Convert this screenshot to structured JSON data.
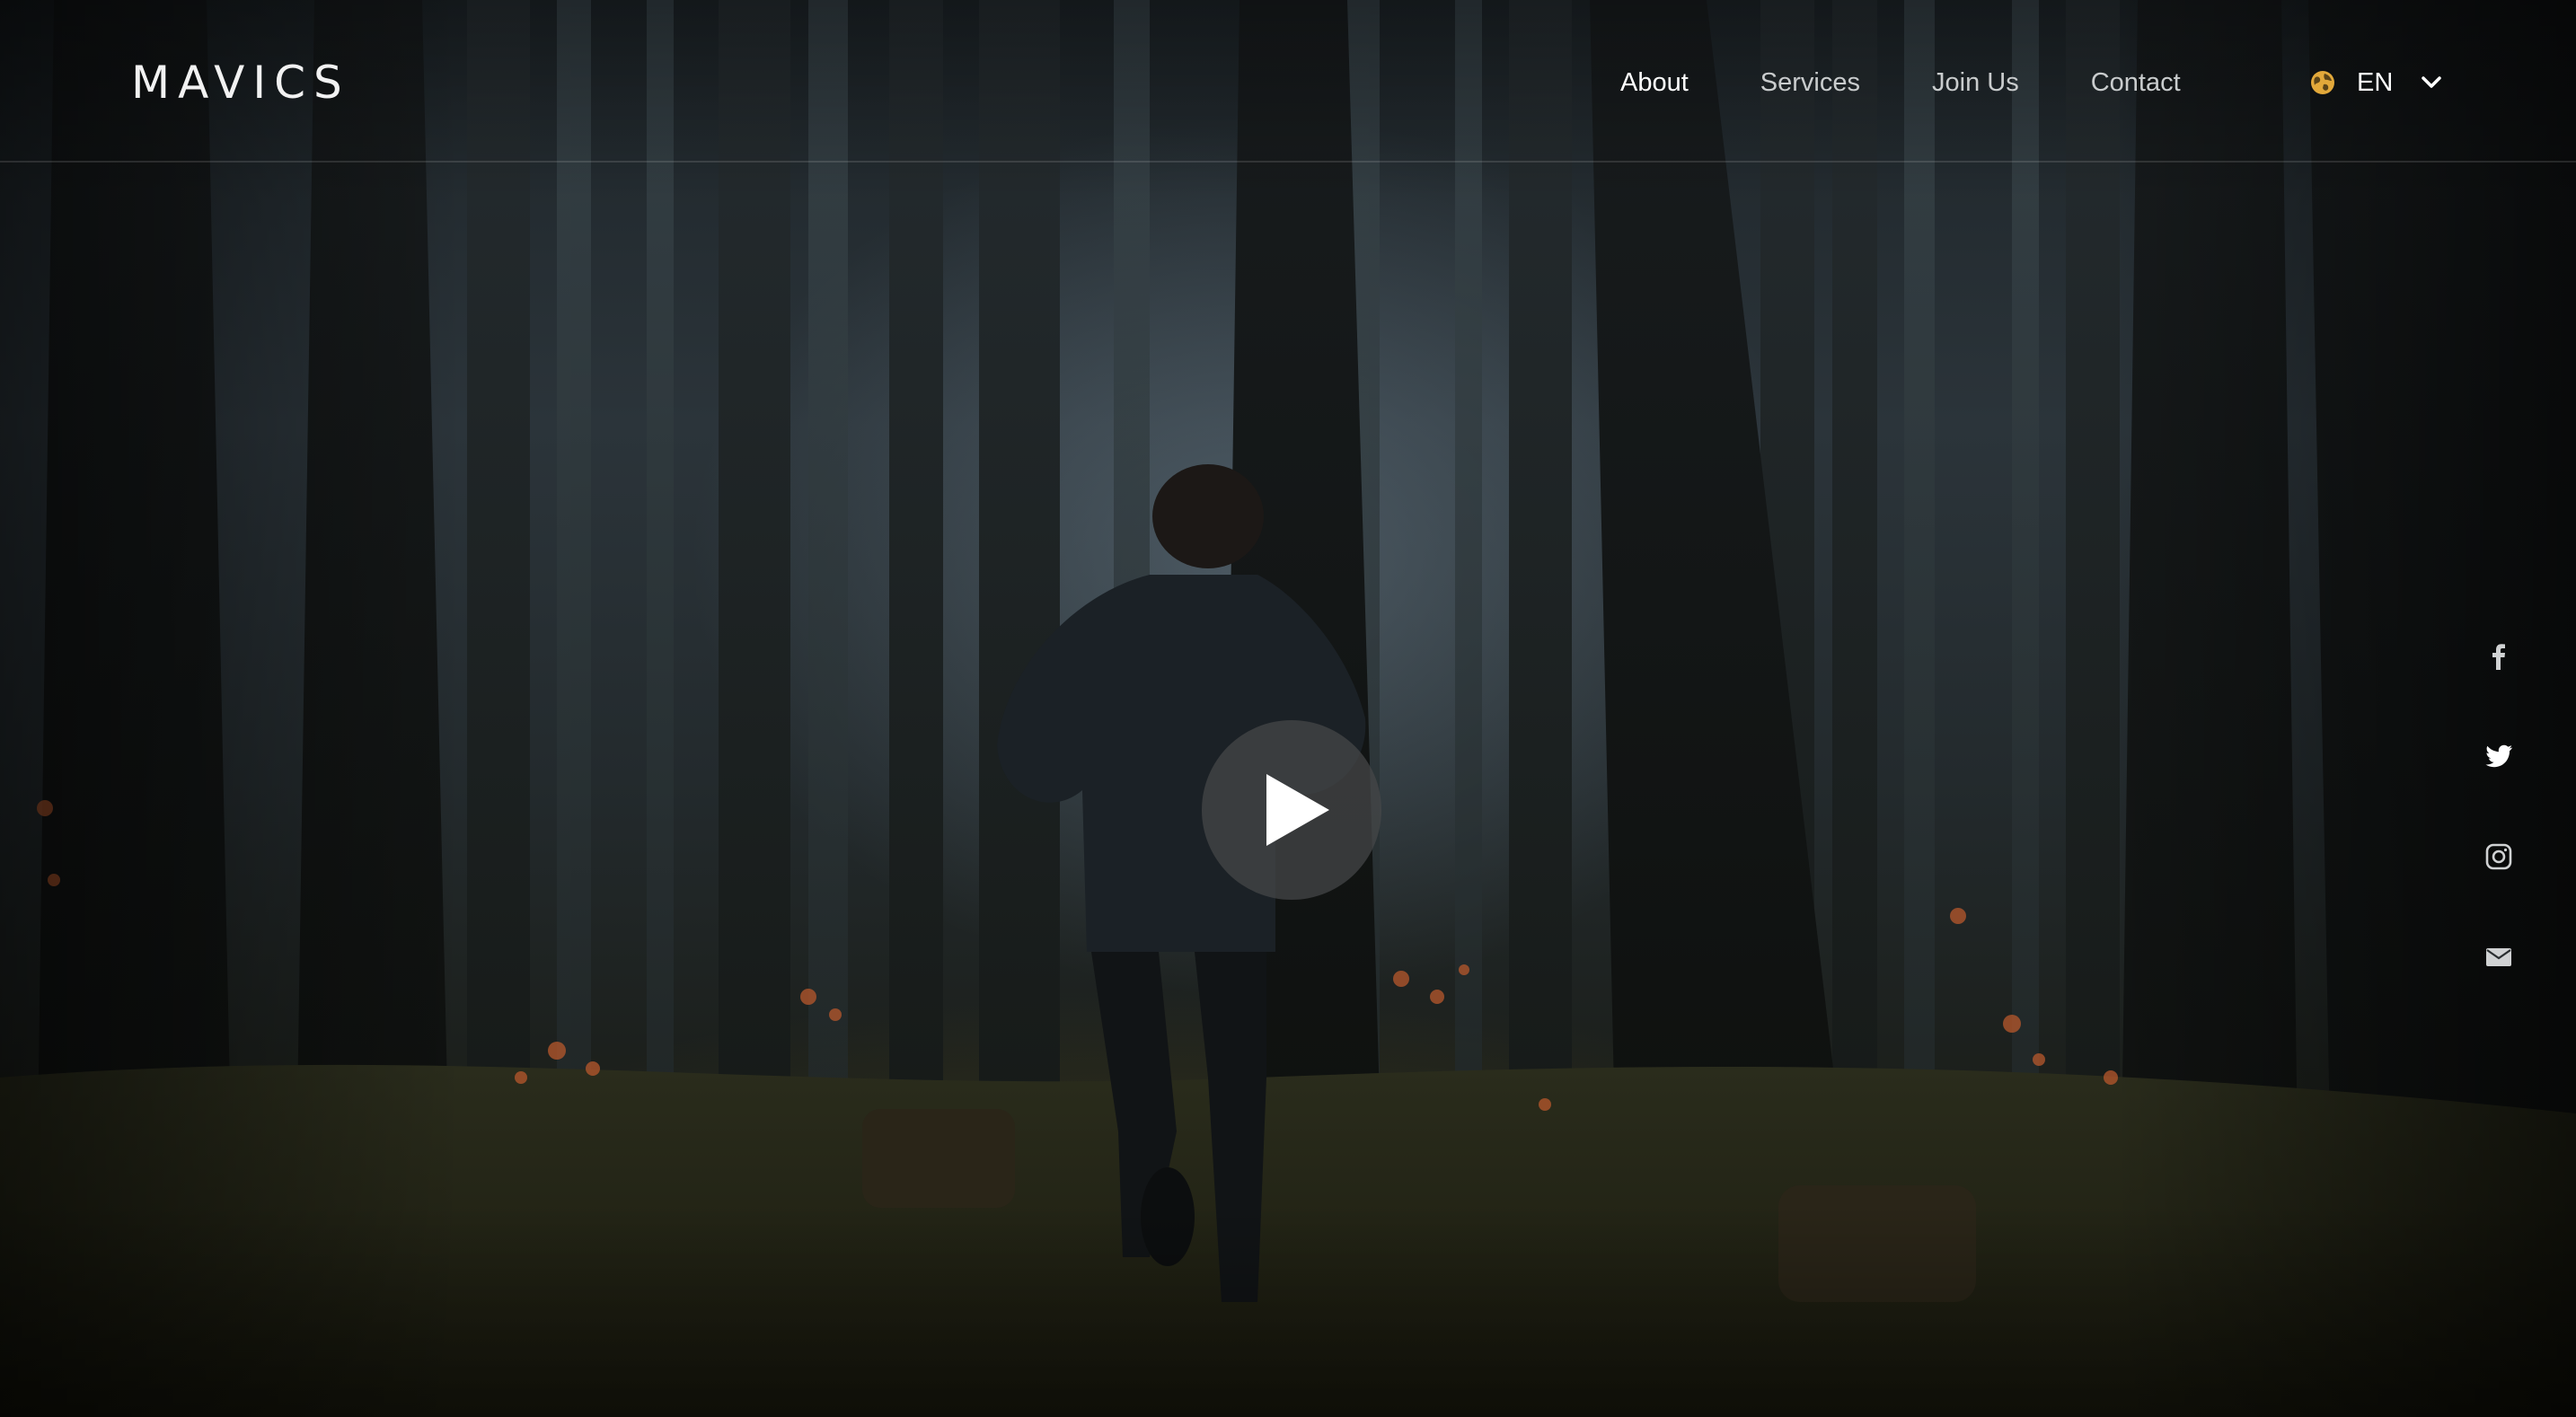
{
  "brand": {
    "name": "MAVICS"
  },
  "nav": {
    "items": [
      {
        "label": "About",
        "active": true
      },
      {
        "label": "Services",
        "active": false
      },
      {
        "label": "Join Us",
        "active": false
      },
      {
        "label": "Contact",
        "active": false
      }
    ]
  },
  "language": {
    "code": "EN",
    "icon": "globe-icon",
    "accent": "#e2a83a"
  },
  "hero": {
    "play_icon": "play-icon"
  },
  "social": {
    "items": [
      {
        "name": "facebook-icon"
      },
      {
        "name": "twitter-icon"
      },
      {
        "name": "instagram-icon"
      },
      {
        "name": "email-icon"
      }
    ]
  }
}
